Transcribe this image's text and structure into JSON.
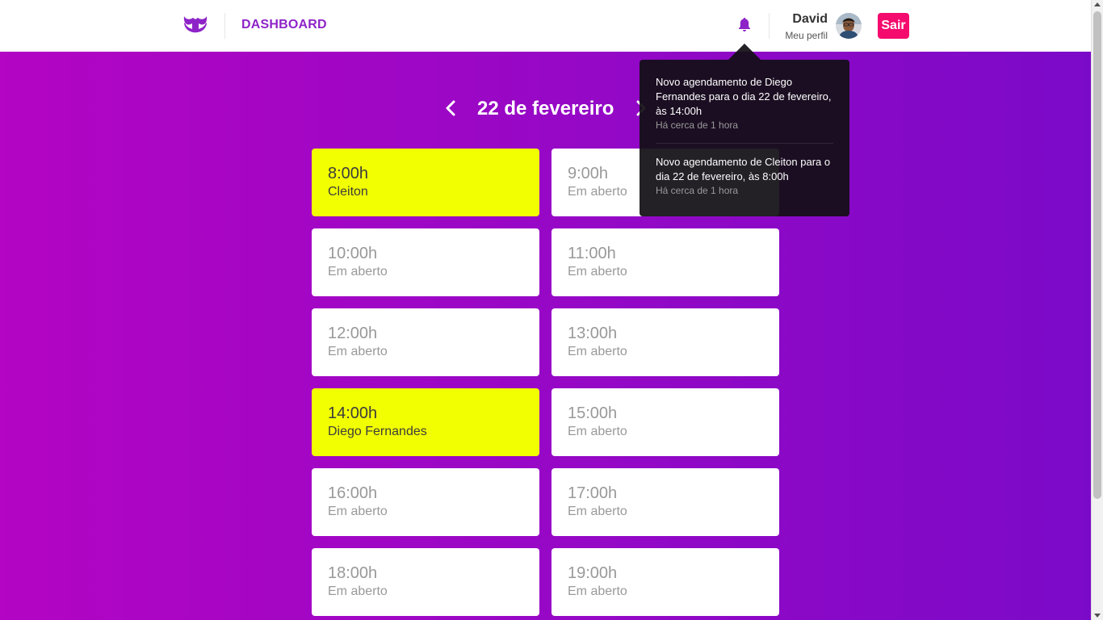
{
  "header": {
    "brand": "DASHBOARD",
    "profile_name": "David",
    "profile_link": "Meu perfil",
    "logout_label": "Sair",
    "icons": [
      "mustache-logo-icon",
      "bell-icon"
    ]
  },
  "date_nav": {
    "title": "22 de fevereiro",
    "icons": [
      "chevron-left-icon",
      "chevron-right-icon"
    ]
  },
  "slots": [
    {
      "time": "8:00h",
      "label": "Cleiton",
      "booked": true
    },
    {
      "time": "9:00h",
      "label": "Em aberto",
      "booked": false
    },
    {
      "time": "10:00h",
      "label": "Em aberto",
      "booked": false
    },
    {
      "time": "11:00h",
      "label": "Em aberto",
      "booked": false
    },
    {
      "time": "12:00h",
      "label": "Em aberto",
      "booked": false
    },
    {
      "time": "13:00h",
      "label": "Em aberto",
      "booked": false
    },
    {
      "time": "14:00h",
      "label": "Diego Fernandes",
      "booked": true
    },
    {
      "time": "15:00h",
      "label": "Em aberto",
      "booked": false
    },
    {
      "time": "16:00h",
      "label": "Em aberto",
      "booked": false
    },
    {
      "time": "17:00h",
      "label": "Em aberto",
      "booked": false
    },
    {
      "time": "18:00h",
      "label": "Em aberto",
      "booked": false
    },
    {
      "time": "19:00h",
      "label": "Em aberto",
      "booked": false
    }
  ],
  "notifications": [
    {
      "text": "Novo agendamento de Diego Fernandes para o dia 22 de fevereiro, às 14:00h",
      "time": "Há cerca de 1 hora"
    },
    {
      "text": "Novo agendamento de Cleiton para o dia 22 de fevereiro, às 8:00h",
      "time": "Há cerca de 1 hora"
    }
  ],
  "colors": {
    "brand": "#8e24c8",
    "gradient_start": "#b305c3",
    "gradient_end": "#7b0ac8",
    "booked": "#f2ff00",
    "logout": "#f50a6d"
  }
}
